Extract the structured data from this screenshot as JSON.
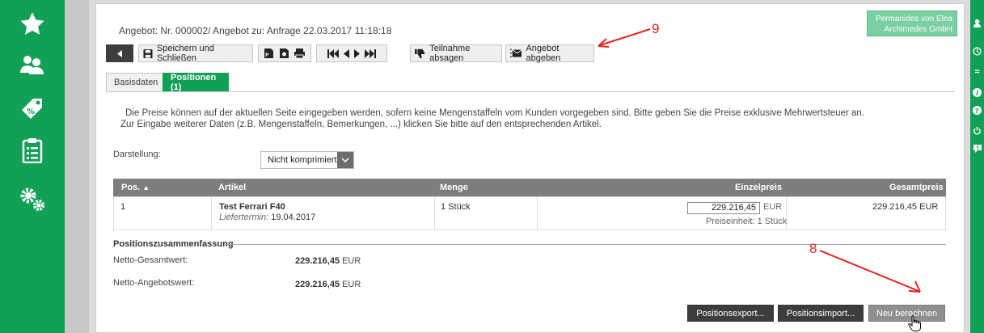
{
  "sidebar": {
    "icons": [
      "star-icon",
      "users-icon",
      "price-tag-icon",
      "clipboard-list-icon",
      "gears-icon"
    ]
  },
  "right_rail": {
    "icons": [
      "user-icon",
      "clock-icon",
      "approx-icon",
      "info-icon",
      "help-icon",
      "power-icon",
      "alert-icon"
    ]
  },
  "header": {
    "title": "Angebot: Nr. 000002/ Angebot zu: Anfrage 22.03.2017 11:18:18",
    "company_line1": "Permanides von Elea",
    "company_line2": "Archimedes GmbH"
  },
  "toolbar": {
    "save_close_label": "Speichern und Schließen",
    "decline_label": "Teilnahme absagen",
    "submit_label": "Angebot abgeben"
  },
  "tabs": [
    {
      "label": "Basisdaten"
    },
    {
      "label": "Positionen (1)"
    }
  ],
  "info": {
    "line1": "Die Preise können auf der aktuellen Seite eingegeben werden, sofern keine Mengenstaffeln vom Kunden vorgegeben sind. Bitte geben Sie die Preise exklusive Mehrwertsteuer an.",
    "line2": "Zur Eingabe weiterer Daten (z.B. Mengenstaffeln, Bemerkungen, ...) klicken Sie bitte auf den entsprechenden Artikel."
  },
  "display": {
    "label": "Darstellung:",
    "selected": "Nicht komprimiert"
  },
  "table": {
    "headers": {
      "pos": "Pos.",
      "artikel": "Artikel",
      "menge": "Menge",
      "einzelpreis": "Einzelpreis",
      "gesamtpreis": "Gesamtpreis"
    },
    "rows": [
      {
        "pos": "1",
        "artikel": "Test Ferrari F40",
        "liefertermin_label": "Liefertermin:",
        "liefertermin": "19.04.2017",
        "menge": "1 Stück",
        "einzelpreis": "229.216,45",
        "currency": "EUR",
        "preiseinheit": "Preiseinheit: 1 Stück",
        "gesamtpreis": "229.216,45 EUR"
      }
    ]
  },
  "summary": {
    "title": "Positionszusammenfassung",
    "netto_gesamt_label": "Netto-Gesamtwert:",
    "netto_gesamt_value": "229.216,45",
    "netto_angebot_label": "Netto-Angebotswert:",
    "netto_angebot_value": "229.216,45",
    "currency": "EUR"
  },
  "buttons": {
    "export": "Positionsexport...",
    "import": "Positionsimport...",
    "recalc": "Neu berechnen"
  },
  "annotations": {
    "label_9": "9",
    "label_8": "8",
    "color": "#e52222"
  }
}
